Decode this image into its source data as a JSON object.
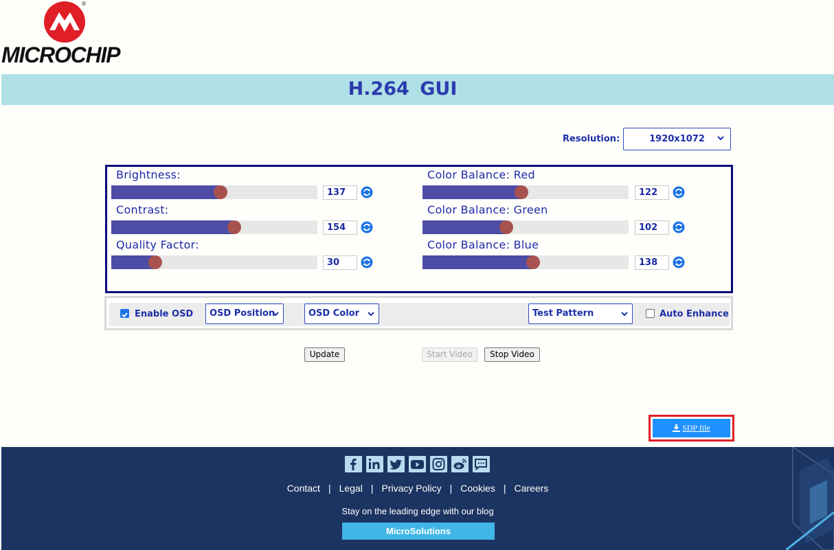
{
  "brand": {
    "logo_text": "MICROCHIP",
    "registered_mark": "®"
  },
  "header": {
    "title": "H.264  GUI"
  },
  "resolution": {
    "label": "Resolution:",
    "value": "1920x1072"
  },
  "sliders": {
    "left": [
      {
        "label": "Brightness:",
        "value": "137",
        "level": 0.53
      },
      {
        "label": "Contrast:",
        "value": "154",
        "level": 0.597
      },
      {
        "label": "Quality Factor:",
        "value": "30",
        "level": 0.213
      }
    ],
    "right": [
      {
        "label": "Color Balance: Red",
        "value": "122",
        "level": 0.48
      },
      {
        "label": "Color Balance: Green",
        "value": "102",
        "level": 0.407
      },
      {
        "label": "Color Balance: Blue",
        "value": "138",
        "level": 0.537
      }
    ]
  },
  "options": {
    "enable_osd": {
      "label": "Enable OSD",
      "checked": true
    },
    "osd_position": "OSD Position",
    "osd_color": "OSD Color",
    "test_pattern": "Test Pattern",
    "auto_enhance": {
      "label": "Auto Enhance",
      "checked": false
    }
  },
  "buttons": {
    "update": "Update",
    "start_video": "Start Video",
    "stop_video": "Stop Video",
    "sdp_file": "SDP file"
  },
  "footer": {
    "social_icons": [
      "facebook-icon",
      "linkedin-icon",
      "twitter-icon",
      "youtube-icon",
      "instagram-icon",
      "weibo-icon",
      "wechat-icon"
    ],
    "links": [
      "Contact",
      "Legal",
      "Privacy Policy",
      "Cookies",
      "Careers"
    ],
    "blog_text": "Stay on the leading edge with our blog",
    "microsolutions": "MicroSolutions"
  },
  "colors": {
    "accent_blue": "#1d2ea8",
    "title_bar": "#b0e0e6",
    "slider_fill": "#4d4da6",
    "slider_thumb": "#a85250",
    "footer_bg": "#1c3461",
    "sdp_button": "#1e90ff",
    "sdp_highlight": "#e01e26"
  }
}
